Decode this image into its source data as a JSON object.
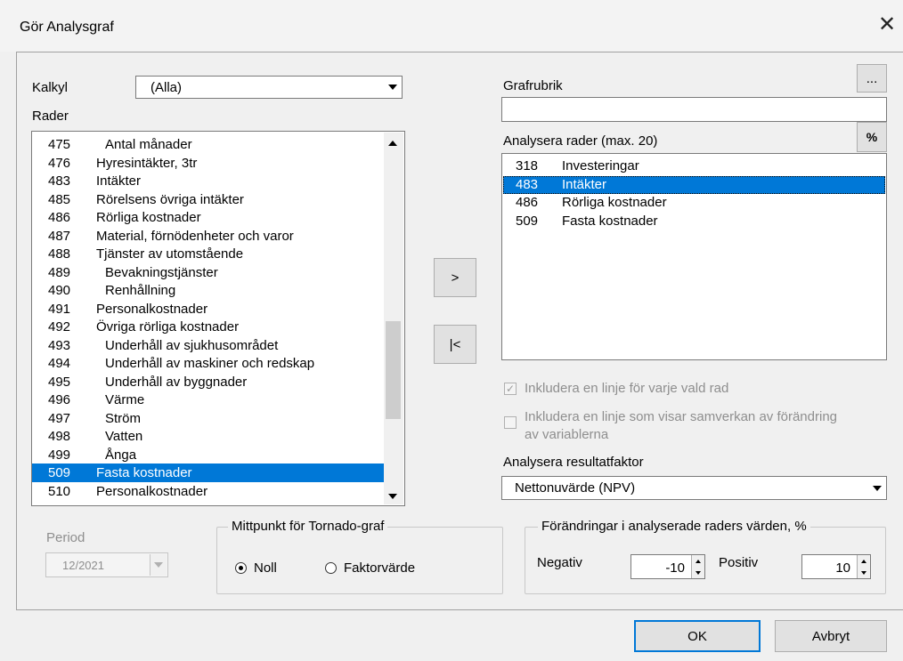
{
  "window": {
    "title": "Gör Analysgraf",
    "close_glyph": "✕"
  },
  "kalkyl": {
    "label": "Kalkyl",
    "value": "(Alla)"
  },
  "rader": {
    "label": "Rader",
    "items": [
      {
        "num": "475",
        "name": "Antal månader",
        "indent": 1
      },
      {
        "num": "476",
        "name": "Hyresintäkter, 3tr",
        "indent": 0
      },
      {
        "num": "483",
        "name": "Intäkter",
        "indent": 0
      },
      {
        "num": "485",
        "name": "Rörelsens övriga intäkter",
        "indent": 0
      },
      {
        "num": "486",
        "name": "Rörliga kostnader",
        "indent": 0
      },
      {
        "num": "487",
        "name": "Material, förnödenheter och varor",
        "indent": 0
      },
      {
        "num": "488",
        "name": "Tjänster av utomstående",
        "indent": 0
      },
      {
        "num": "489",
        "name": "Bevakningstjänster",
        "indent": 1
      },
      {
        "num": "490",
        "name": "Renhållning",
        "indent": 1
      },
      {
        "num": "491",
        "name": "Personalkostnader",
        "indent": 0
      },
      {
        "num": "492",
        "name": "Övriga rörliga kostnader",
        "indent": 0
      },
      {
        "num": "493",
        "name": "Underhåll av sjukhusområdet",
        "indent": 1
      },
      {
        "num": "494",
        "name": "Underhåll av maskiner och redskap",
        "indent": 1
      },
      {
        "num": "495",
        "name": "Underhåll av byggnader",
        "indent": 1
      },
      {
        "num": "496",
        "name": "Värme",
        "indent": 1
      },
      {
        "num": "497",
        "name": "Ström",
        "indent": 1
      },
      {
        "num": "498",
        "name": "Vatten",
        "indent": 1
      },
      {
        "num": "499",
        "name": "Ånga",
        "indent": 1
      },
      {
        "num": "509",
        "name": "Fasta kostnader",
        "indent": 0,
        "selected": true
      },
      {
        "num": "510",
        "name": "Personalkostnader",
        "indent": 0
      }
    ]
  },
  "move_buttons": {
    "add": ">",
    "remove": "|<"
  },
  "grafrubrik": {
    "label": "Grafrubrik",
    "value": "",
    "browse_label": "..."
  },
  "analysera_rader": {
    "label": "Analysera rader (max. 20)",
    "percent_label": "%",
    "items": [
      {
        "num": "318",
        "name": "Investeringar"
      },
      {
        "num": "483",
        "name": "Intäkter",
        "selected": true
      },
      {
        "num": "486",
        "name": "Rörliga kostnader"
      },
      {
        "num": "509",
        "name": "Fasta kostnader"
      }
    ]
  },
  "options": {
    "include_each_line": {
      "label": "Inkludera en linje för varje vald rad",
      "checked": true,
      "enabled": false
    },
    "include_interaction_line1": "Inkludera en linje som visar samverkan av förändring",
    "include_interaction_line2": "av variablerna",
    "include_interaction_checked": false
  },
  "resultatfaktor": {
    "label": "Analysera resultatfaktor",
    "value": "Nettonuvärde (NPV)"
  },
  "period": {
    "label": "Period",
    "value": "12/2021",
    "enabled": false
  },
  "mittpunkt": {
    "legend": "Mittpunkt för Tornado-graf",
    "options": [
      {
        "label": "Noll",
        "selected": true
      },
      {
        "label": "Faktorvärde",
        "selected": false
      }
    ]
  },
  "forandringar": {
    "legend": "Förändringar i analyserade raders värden, %",
    "negativ_label": "Negativ",
    "negativ_value": "-10",
    "positiv_label": "Positiv",
    "positiv_value": "10"
  },
  "footer": {
    "ok_label": "OK",
    "cancel_label": "Avbryt"
  },
  "colors": {
    "selection": "#0078d7",
    "background": "#f0f0f0"
  }
}
